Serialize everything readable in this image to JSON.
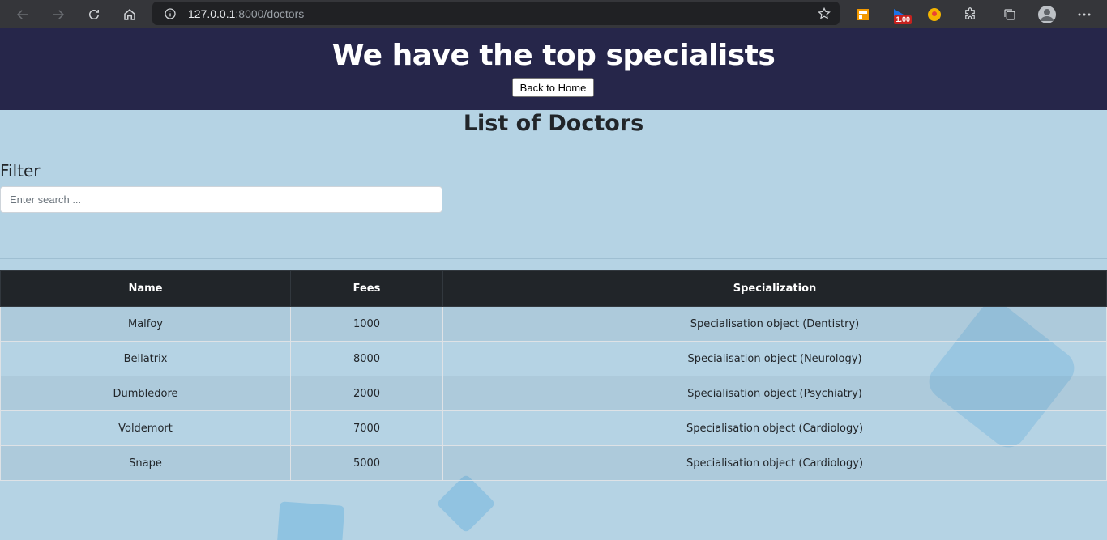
{
  "browser": {
    "url_host": "127.0.0.1",
    "url_path": ":8000/doctors",
    "extension_badge": "1.00"
  },
  "header": {
    "title": "We have the top specialists",
    "home_button": "Back to Home"
  },
  "main": {
    "list_title": "List of Doctors",
    "filter_label": "Filter",
    "search_placeholder": "Enter search ..."
  },
  "table": {
    "columns": [
      "Name",
      "Fees",
      "Specialization"
    ],
    "rows": [
      [
        "Malfoy",
        "1000",
        "Specialisation object (Dentistry)"
      ],
      [
        "Bellatrix",
        "8000",
        "Specialisation object (Neurology)"
      ],
      [
        "Dumbledore",
        "2000",
        "Specialisation object (Psychiatry)"
      ],
      [
        "Voldemort",
        "7000",
        "Specialisation object (Cardiology)"
      ],
      [
        "Snape",
        "5000",
        "Specialisation object (Cardiology)"
      ]
    ]
  },
  "colors": {
    "header_bg": "#26264a",
    "page_bg": "#b5d3e4",
    "table_head_bg": "#212529"
  }
}
